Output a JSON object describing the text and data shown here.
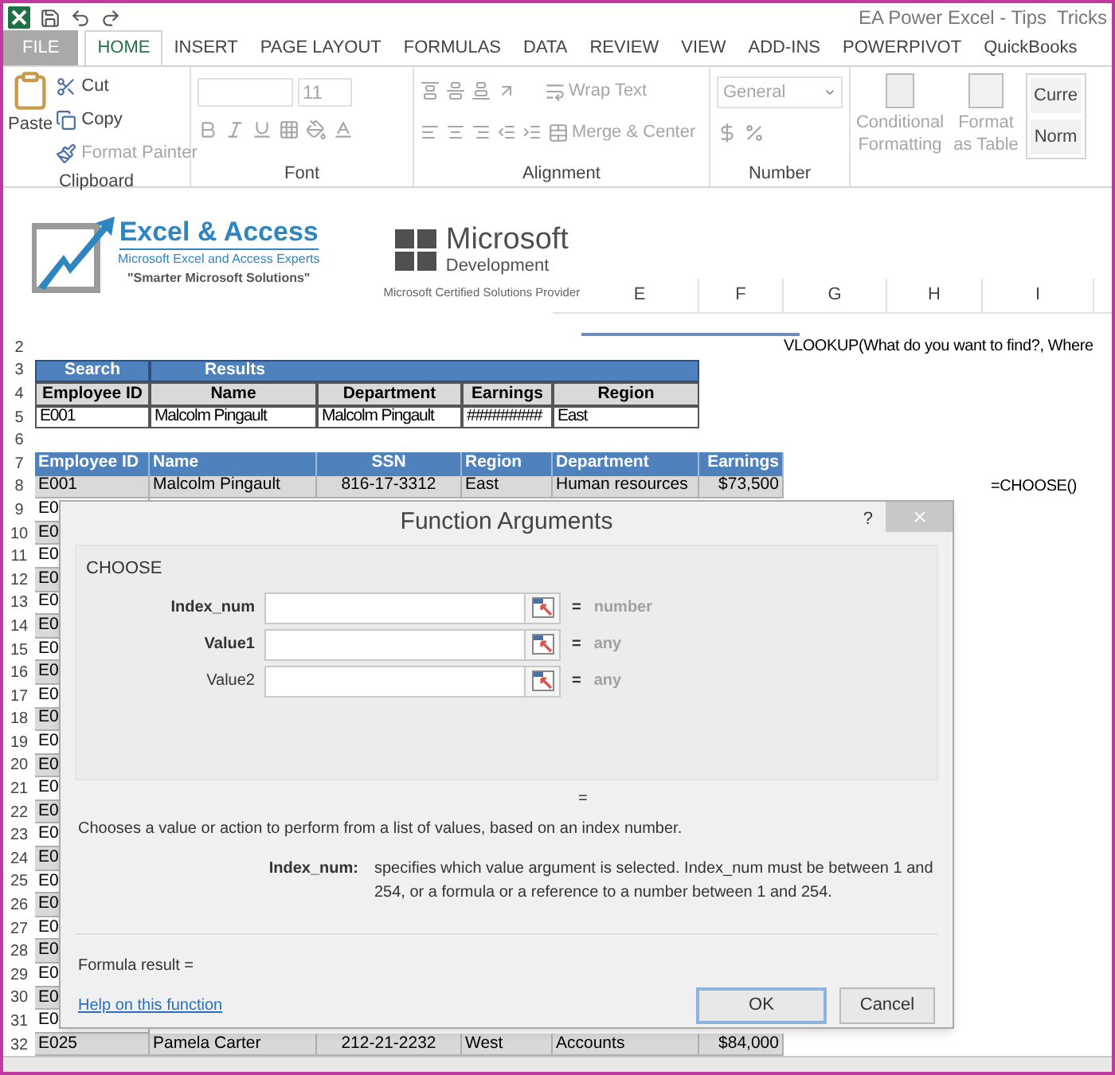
{
  "title_bar": {
    "title": "EA Power Excel - Tips  Tricks"
  },
  "ribbon_tabs": [
    {
      "label": "FILE",
      "kind": "file",
      "selected": false
    },
    {
      "label": "HOME",
      "kind": "tab",
      "selected": true
    },
    {
      "label": "INSERT",
      "kind": "tab",
      "selected": false
    },
    {
      "label": "PAGE LAYOUT",
      "kind": "tab",
      "selected": false
    },
    {
      "label": "FORMULAS",
      "kind": "tab",
      "selected": false
    },
    {
      "label": "DATA",
      "kind": "tab",
      "selected": false
    },
    {
      "label": "REVIEW",
      "kind": "tab",
      "selected": false
    },
    {
      "label": "VIEW",
      "kind": "tab",
      "selected": false
    },
    {
      "label": "ADD-INS",
      "kind": "tab",
      "selected": false
    },
    {
      "label": "POWERPIVOT",
      "kind": "tab",
      "selected": false
    },
    {
      "label": "QuickBooks",
      "kind": "tab",
      "selected": false
    }
  ],
  "ribbon": {
    "clipboard": {
      "label": "Clipboard",
      "paste": "Paste",
      "items": [
        {
          "label": "Cut",
          "disabled": false
        },
        {
          "label": "Copy",
          "disabled": false
        },
        {
          "label": "Format Painter",
          "disabled": true
        }
      ]
    },
    "font": {
      "label": "Font",
      "size": "11",
      "disabled": true
    },
    "alignment": {
      "label": "Alignment",
      "wrap": "Wrap Text",
      "merge": "Merge & Center",
      "disabled": true
    },
    "number": {
      "label": "Number",
      "format": "General",
      "disabled": true
    },
    "styles": {
      "conditional": "Conditional Formatting",
      "format_table": "Format as Table",
      "cell_styles": [
        "Curre",
        "Norm"
      ],
      "disabled": true
    }
  },
  "logos": {
    "excel_access": {
      "name": "Excel & Access",
      "subtitle": "Microsoft Excel and Access Experts",
      "tagline": "\"Smarter Microsoft Solutions\""
    },
    "microsoft": {
      "name": "Microsoft",
      "sub": "Development",
      "caption": "Microsoft Certified Solutions Provider"
    }
  },
  "sheet": {
    "column_headers": [
      "E",
      "F",
      "G",
      "H",
      "I"
    ],
    "rows": [
      {
        "number": "2",
        "kind": "blank",
        "note": "VLOOKUP(What do you want to find?, Where"
      },
      {
        "number": "3",
        "kind": "title",
        "cells": [
          "Search",
          "Results"
        ]
      },
      {
        "number": "4",
        "kind": "header",
        "cells": [
          "Employee ID",
          "Name",
          "Department",
          "Earnings",
          "Region"
        ]
      },
      {
        "number": "5",
        "kind": "plain",
        "cells": [
          "E001",
          "Malcolm Pingault",
          "Malcolm Pingault",
          "#########",
          "East"
        ]
      },
      {
        "number": "6",
        "kind": "blank"
      },
      {
        "number": "7",
        "kind": "table_header",
        "cells": [
          "Employee ID",
          "Name",
          "SSN",
          "Region",
          "Department",
          "Earnings"
        ]
      },
      {
        "number": "8",
        "kind": "band",
        "shaded": true,
        "cells": [
          "E001",
          "Malcolm Pingault",
          "816-17-3312",
          "East",
          "Human resources",
          "$73,500"
        ],
        "note": "=CHOOSE()"
      },
      {
        "number": "9",
        "kind": "band",
        "shaded": false,
        "cells": [
          "E0"
        ]
      },
      {
        "number": "10",
        "kind": "band",
        "shaded": true,
        "cells": [
          "E0"
        ]
      },
      {
        "number": "11",
        "kind": "band",
        "shaded": false,
        "cells": [
          "E0"
        ]
      },
      {
        "number": "12",
        "kind": "band",
        "shaded": true,
        "cells": [
          "E0"
        ]
      },
      {
        "number": "13",
        "kind": "band",
        "shaded": false,
        "cells": [
          "E0"
        ]
      },
      {
        "number": "14",
        "kind": "band",
        "shaded": true,
        "cells": [
          "E0"
        ]
      },
      {
        "number": "15",
        "kind": "band",
        "shaded": false,
        "cells": [
          "E0"
        ]
      },
      {
        "number": "16",
        "kind": "band",
        "shaded": true,
        "cells": [
          "E0"
        ]
      },
      {
        "number": "17",
        "kind": "band",
        "shaded": false,
        "cells": [
          "E0"
        ]
      },
      {
        "number": "18",
        "kind": "band",
        "shaded": true,
        "cells": [
          "E0"
        ]
      },
      {
        "number": "19",
        "kind": "band",
        "shaded": false,
        "cells": [
          "E0"
        ]
      },
      {
        "number": "20",
        "kind": "band",
        "shaded": true,
        "cells": [
          "E0"
        ]
      },
      {
        "number": "21",
        "kind": "band",
        "shaded": false,
        "cells": [
          "E0"
        ]
      },
      {
        "number": "22",
        "kind": "band",
        "shaded": true,
        "cells": [
          "E0"
        ]
      },
      {
        "number": "23",
        "kind": "band",
        "shaded": false,
        "cells": [
          "E0"
        ]
      },
      {
        "number": "24",
        "kind": "band",
        "shaded": true,
        "cells": [
          "E0"
        ]
      },
      {
        "number": "25",
        "kind": "band",
        "shaded": false,
        "cells": [
          "E0"
        ]
      },
      {
        "number": "26",
        "kind": "band",
        "shaded": true,
        "cells": [
          "E0"
        ]
      },
      {
        "number": "27",
        "kind": "band",
        "shaded": false,
        "cells": [
          "E0"
        ]
      },
      {
        "number": "28",
        "kind": "band",
        "shaded": true,
        "cells": [
          "E0"
        ]
      },
      {
        "number": "29",
        "kind": "band",
        "shaded": false,
        "cells": [
          "E0"
        ]
      },
      {
        "number": "30",
        "kind": "band",
        "shaded": true,
        "cells": [
          "E0"
        ]
      },
      {
        "number": "31",
        "kind": "band",
        "shaded": false,
        "cells": [
          "E0"
        ]
      },
      {
        "number": "32",
        "kind": "band",
        "shaded": true,
        "cells": [
          "E025",
          "Pamela Carter",
          "212-21-2232",
          "West",
          "Accounts",
          "$84,000"
        ]
      }
    ]
  },
  "dialog": {
    "title": "Function Arguments",
    "help": "?",
    "function_name": "CHOOSE",
    "arguments": [
      {
        "label": "Index_num",
        "required": true,
        "equals": "=",
        "result": "number"
      },
      {
        "label": "Value1",
        "required": true,
        "equals": "=",
        "result": "any"
      },
      {
        "label": "Value2",
        "required": false,
        "equals": "=",
        "result": "any"
      }
    ],
    "equals": "=",
    "description": "Chooses a value or action to perform from a list of values, based on an index number.",
    "argument_help": {
      "name": "Index_num:",
      "text": "specifies which value argument is selected. Index_num must be between 1 and 254, or a formula or a reference to a number between 1 and 254."
    },
    "formula_result": "Formula result =",
    "help_link": "Help on this function",
    "buttons": [
      {
        "label": "OK",
        "default": true
      },
      {
        "label": "Cancel",
        "default": false
      }
    ]
  }
}
